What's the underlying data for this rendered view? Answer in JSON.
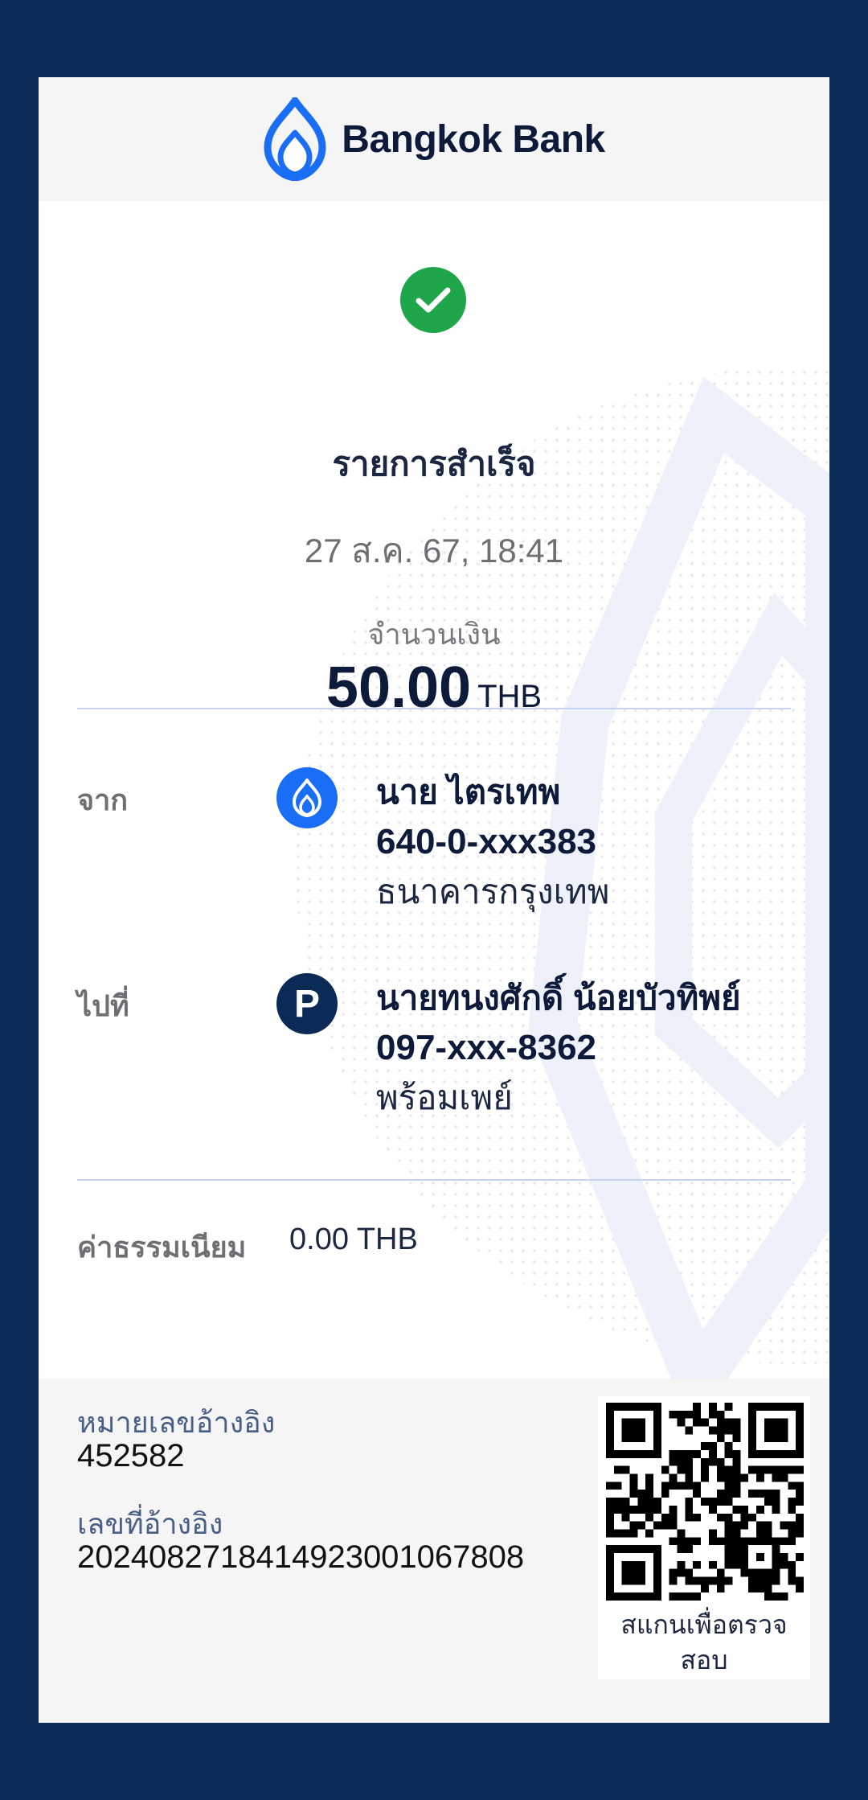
{
  "brand": {
    "name": "Bangkok Bank"
  },
  "status": {
    "title": "รายการสำเร็จ",
    "icon": "check-circle-icon",
    "color": "#1fa64a"
  },
  "transaction": {
    "timestamp": "27 ส.ค. 67, 18:41",
    "amount_label": "จำนวนเงิน",
    "amount": "50.00",
    "currency": "THB"
  },
  "from": {
    "label": "จาก",
    "icon": "bangkok-bank-icon",
    "name": "นาย ไตรเทพ",
    "account": "640-0-xxx383",
    "bank": "ธนาคารกรุงเทพ"
  },
  "to": {
    "label": "ไปที่",
    "icon": "promptpay-icon",
    "icon_letter": "P",
    "name": "นายทนงศักดิ์ น้อยบัวทิพย์",
    "account": "097-xxx-8362",
    "bank": "พร้อมเพย์"
  },
  "fee": {
    "label": "ค่าธรรมเนียม",
    "value": "0.00 THB"
  },
  "reference": {
    "ref_no_label": "หมายเลขอ้างอิง",
    "ref_no": "452582",
    "ref_id_label": "เลขที่อ้างอิง",
    "ref_id": "2024082718414923001067808"
  },
  "qr": {
    "caption_line1": "สแกนเพื่อตรวจ",
    "caption_line2": "สอบ"
  },
  "colors": {
    "brand_blue": "#1a6ef5",
    "navy": "#0b2a55",
    "success": "#1fa64a"
  }
}
